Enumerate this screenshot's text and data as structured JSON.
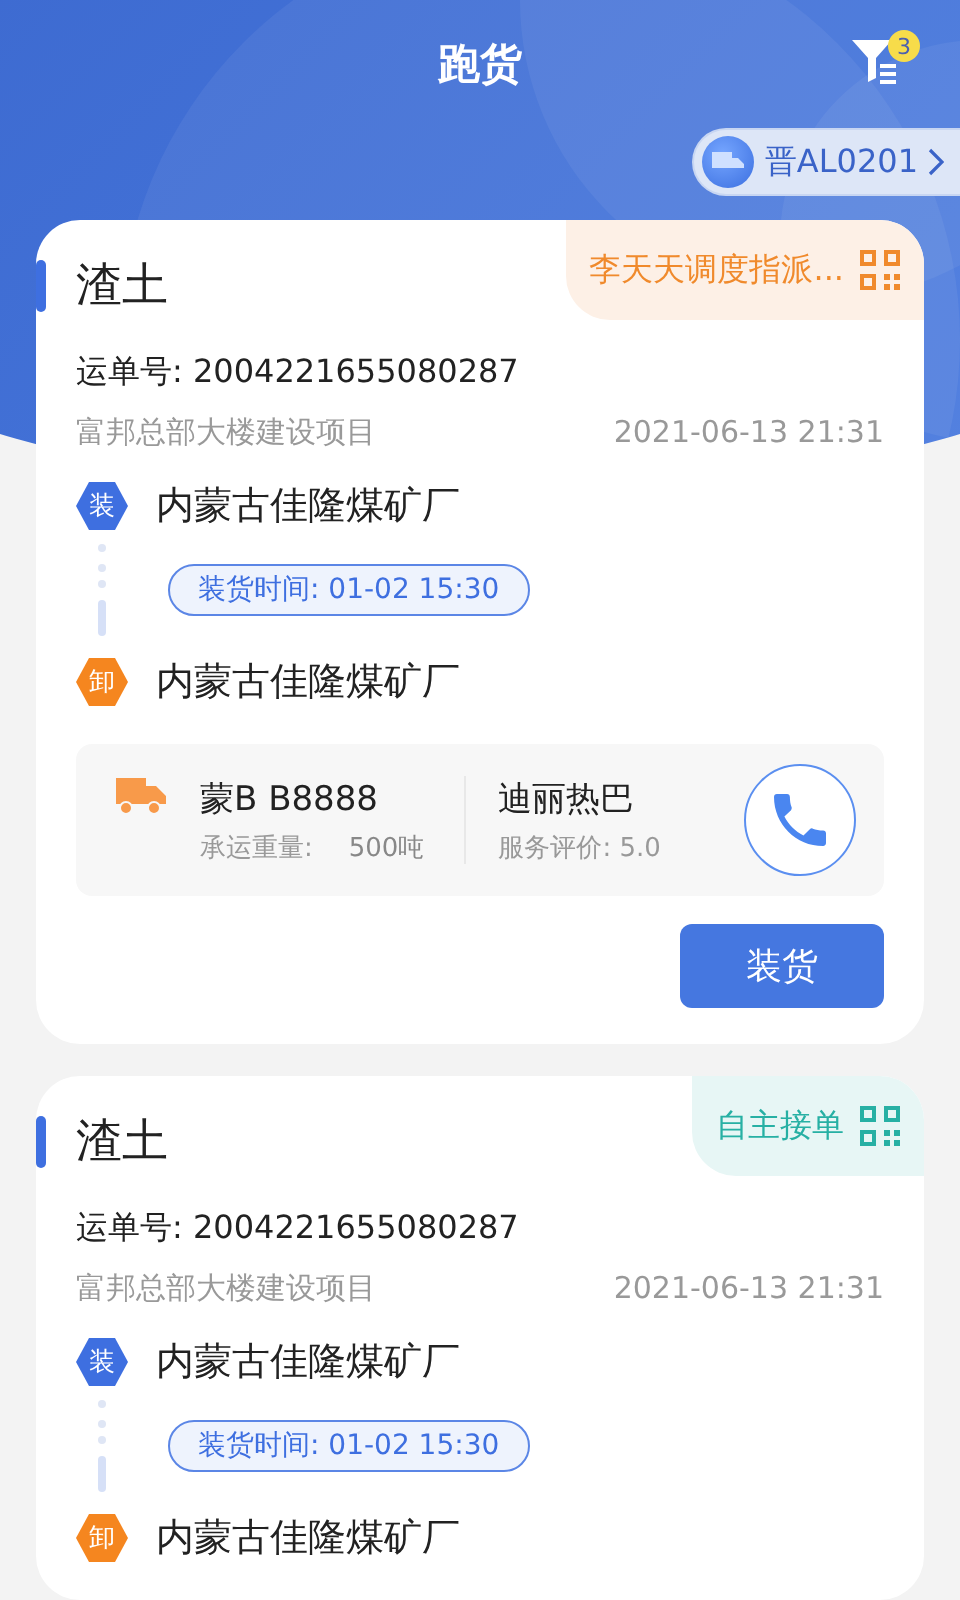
{
  "header": {
    "title": "跑货",
    "filter_count": "3",
    "vehicle_plate": "晋AL0201"
  },
  "orders": [
    {
      "cargo": "渣土",
      "tag": {
        "kind": "dispatch",
        "text": "李天天调度指派..."
      },
      "waybill": "运单号: 2004221655080287",
      "project": "富邦总部大楼建设项目",
      "time": "2021-06-13 21:31",
      "stops": [
        {
          "kind": "load",
          "badge": "装",
          "place": "内蒙古佳隆煤矿厂"
        },
        {
          "kind": "unload",
          "badge": "卸",
          "place": "内蒙古佳隆煤矿厂"
        }
      ],
      "load_time": "装货时间: 01-02 15:30",
      "vehicle": {
        "plate": "蒙B B8888",
        "weight_label": "承运重量:",
        "weight": "500吨",
        "driver": "迪丽热巴",
        "rating": "服务评价: 5.0"
      },
      "action": "装货"
    },
    {
      "cargo": "渣土",
      "tag": {
        "kind": "self",
        "text": "自主接单"
      },
      "waybill": "运单号: 2004221655080287",
      "project": "富邦总部大楼建设项目",
      "time": "2021-06-13 21:31",
      "stops": [
        {
          "kind": "load",
          "badge": "装",
          "place": "内蒙古佳隆煤矿厂"
        },
        {
          "kind": "unload",
          "badge": "卸",
          "place": "内蒙古佳隆煤矿厂"
        }
      ],
      "load_time": "装货时间: 01-02 15:30"
    }
  ]
}
